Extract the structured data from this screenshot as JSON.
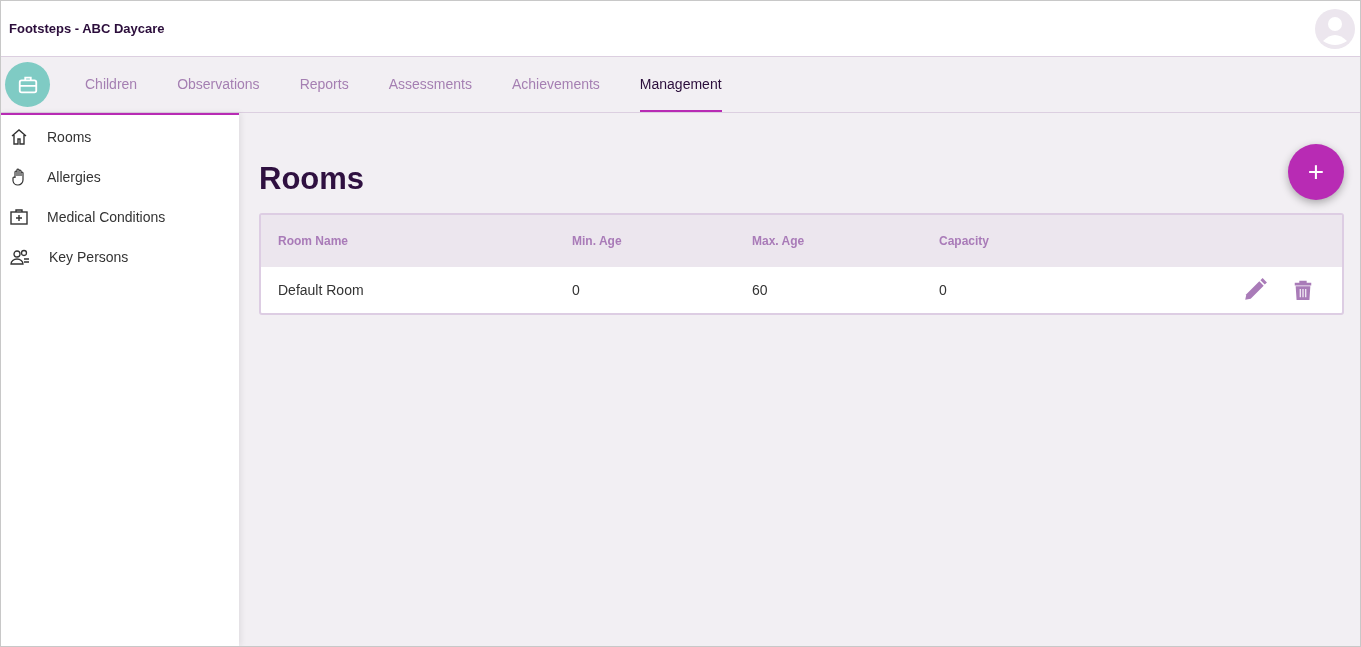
{
  "app_title": "Footsteps - ABC Daycare",
  "tabs": [
    {
      "label": "Children",
      "selected": false
    },
    {
      "label": "Observations",
      "selected": false
    },
    {
      "label": "Reports",
      "selected": false
    },
    {
      "label": "Assessments",
      "selected": false
    },
    {
      "label": "Achievements",
      "selected": false
    },
    {
      "label": "Management",
      "selected": true
    }
  ],
  "sidebar": {
    "items": [
      {
        "label": "Rooms",
        "kind": "home"
      },
      {
        "label": "Allergies",
        "kind": "hand"
      },
      {
        "label": "Medical Conditions",
        "kind": "medical"
      },
      {
        "label": "Key Persons",
        "kind": "people"
      }
    ]
  },
  "page_title": "Rooms",
  "add_button": "+",
  "table": {
    "columns": [
      "Room Name",
      "Min. Age",
      "Max. Age",
      "Capacity"
    ],
    "rows": [
      {
        "cells": [
          "Default Room",
          "0",
          "60",
          "0"
        ]
      }
    ]
  }
}
